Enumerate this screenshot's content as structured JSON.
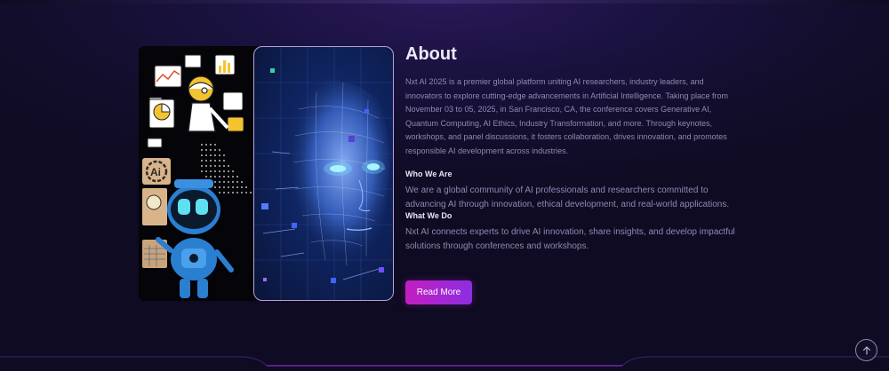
{
  "about": {
    "title": "About",
    "intro": "Nxt AI 2025 is a premier global platform uniting AI researchers, industry leaders, and innovators to explore cutting-edge advancements in Artificial Intelligence. Taking place from November 03 to 05, 2025, in San Francisco, CA, the conference covers Generative AI, Quantum Computing, AI Ethics, Industry Transformation, and more. Through keynotes, workshops, and panel discussions, it fosters collaboration, drives innovation, and promotes responsible AI development across industries.",
    "who_we_are": {
      "heading": "Who We Are",
      "text": "We are a global community of AI professionals and researchers committed to advancing AI through innovation, ethical development, and real-world applications."
    },
    "what_we_do": {
      "heading": "What We Do",
      "text": "Nxt AI connects experts to drive AI innovation, share insights, and develop impactful solutions through conferences and workshops."
    },
    "read_more_label": "Read More"
  },
  "collage": {
    "ai_badge": "Ai",
    "left_image": "robot-analytics-illustration",
    "right_image": "ai-digital-face-illustration"
  },
  "scroll_top_icon": "arrow-up-icon",
  "colors": {
    "accent_start": "#c21ec0",
    "accent_end": "#8d2ee0",
    "background": "#120d2a"
  }
}
